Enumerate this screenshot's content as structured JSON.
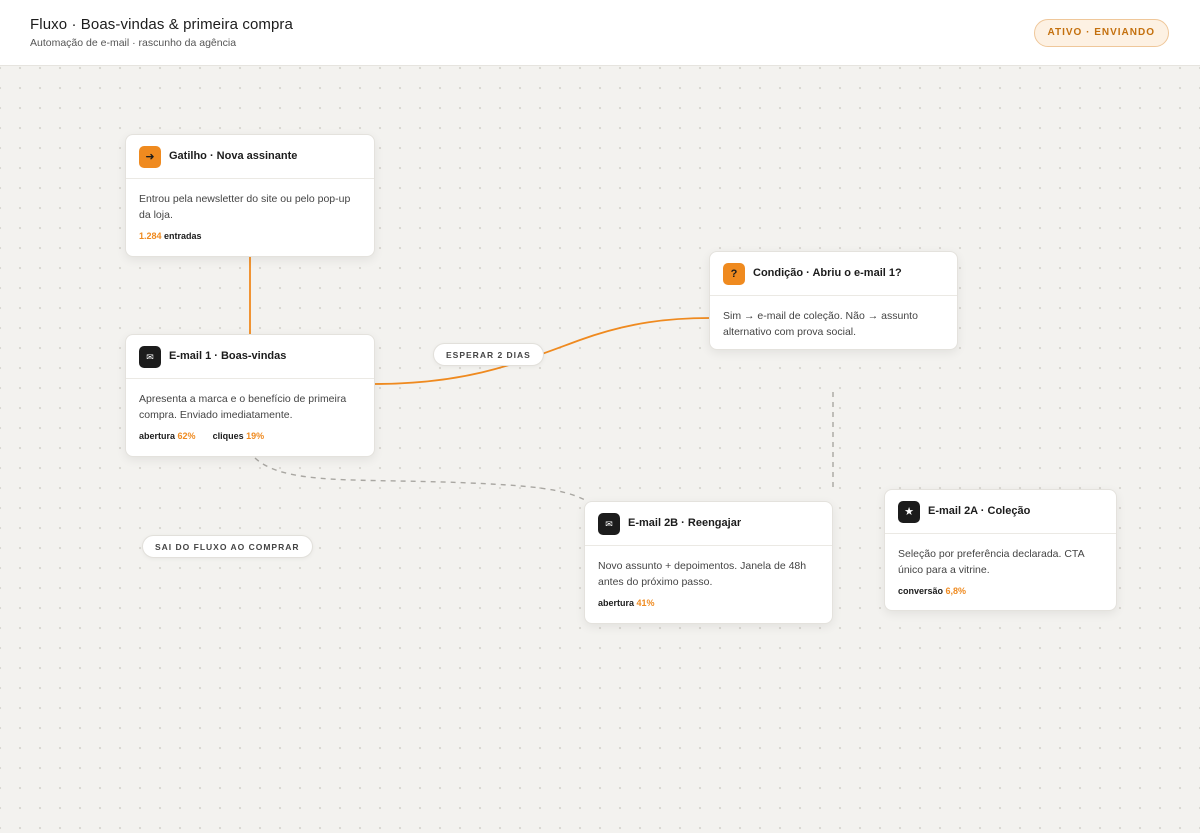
{
  "header": {
    "title": "Fluxo · Boas-vindas & primeira compra",
    "subtitle": "Automação de e-mail · rascunho da agência",
    "status": "ATIVO · ENVIANDO"
  },
  "colors": {
    "accent": "#ef8a1f",
    "dark": "#1c1c1c",
    "canvas": "#f3f2ef"
  },
  "nodes": {
    "trigger": {
      "icon": "arrow-right-icon",
      "icon_glyph": "➜",
      "title": "Gatilho · Nova assinante",
      "description": "Entrou pela newsletter do site ou pelo pop-up da loja.",
      "metric_value": "1.284",
      "metric_label": "entradas"
    },
    "email1": {
      "icon": "mail-icon",
      "icon_glyph": "✉",
      "title": "E-mail 1 · Boas-vindas",
      "description": "Apresenta a marca e o benefício de primeira compra. Enviado imediatamente.",
      "metric1_label": "abertura",
      "metric1_value": "62%",
      "metric2_label": "cliques",
      "metric2_value": "19%"
    },
    "condition": {
      "icon": "question-icon",
      "icon_glyph": "?",
      "title": "Condição · Abriu o e-mail 1?",
      "description": "Sim → e-mail de coleção. Não → assunto alternativo com prova social."
    },
    "email2b": {
      "icon": "mail-icon",
      "icon_glyph": "✉",
      "title": "E-mail 2B · Reengajar",
      "description": "Novo assunto + depoimentos. Janela de 48h antes do próximo passo.",
      "metric_label": "abertura",
      "metric_value": "41%"
    },
    "email2a": {
      "icon": "star-icon",
      "icon_glyph": "★",
      "title": "E-mail 2A · Coleção",
      "description": "Seleção por preferência declarada. CTA único para a vitrine.",
      "metric_label": "conversão",
      "metric_value": "6,8%"
    }
  },
  "labels": {
    "wait": "ESPERAR 2 DIAS",
    "exit": "SAI DO FLUXO AO COMPRAR"
  }
}
